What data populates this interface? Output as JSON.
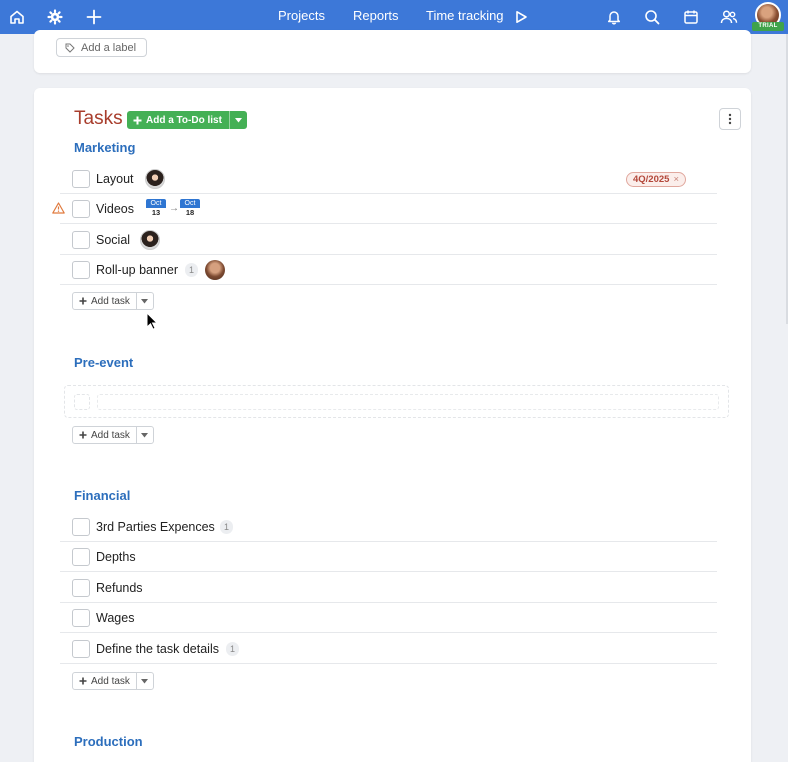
{
  "nav": {
    "links": {
      "projects": "Projects",
      "reports": "Reports",
      "time_tracking": "Time tracking"
    },
    "trial_badge": "TRIAL",
    "icons": [
      "home-icon",
      "gear-icon",
      "plus-icon",
      "play-icon",
      "bell-icon",
      "search-icon",
      "calendar-icon",
      "users-icon"
    ]
  },
  "top_card": {
    "add_label": "Add a label"
  },
  "tasks": {
    "title": "Tasks",
    "add_todo_label": "Add a To-Do list",
    "add_task_label": "Add task",
    "lists": [
      {
        "title": "Marketing",
        "items": [
          {
            "name": "Layout",
            "tag": "4Q/2025"
          },
          {
            "name": "Videos",
            "start": {
              "month": "Oct",
              "day": "13"
            },
            "end": {
              "month": "Oct",
              "day": "18"
            }
          },
          {
            "name": "Social"
          },
          {
            "name": "Roll-up banner",
            "count": "1"
          }
        ]
      },
      {
        "title": "Pre-event",
        "items": []
      },
      {
        "title": "Financial",
        "items": [
          {
            "name": "3rd Parties Expences",
            "count": "1"
          },
          {
            "name": "Depths"
          },
          {
            "name": "Refunds"
          },
          {
            "name": "Wages"
          },
          {
            "name": "Define the task details",
            "count": "1"
          }
        ]
      },
      {
        "title": "Production",
        "items": []
      }
    ]
  },
  "colors": {
    "nav_bg": "#3d78d8",
    "accent_green": "#44b055",
    "list_title": "#2c6ebc",
    "tasks_title": "#a83d2c"
  }
}
